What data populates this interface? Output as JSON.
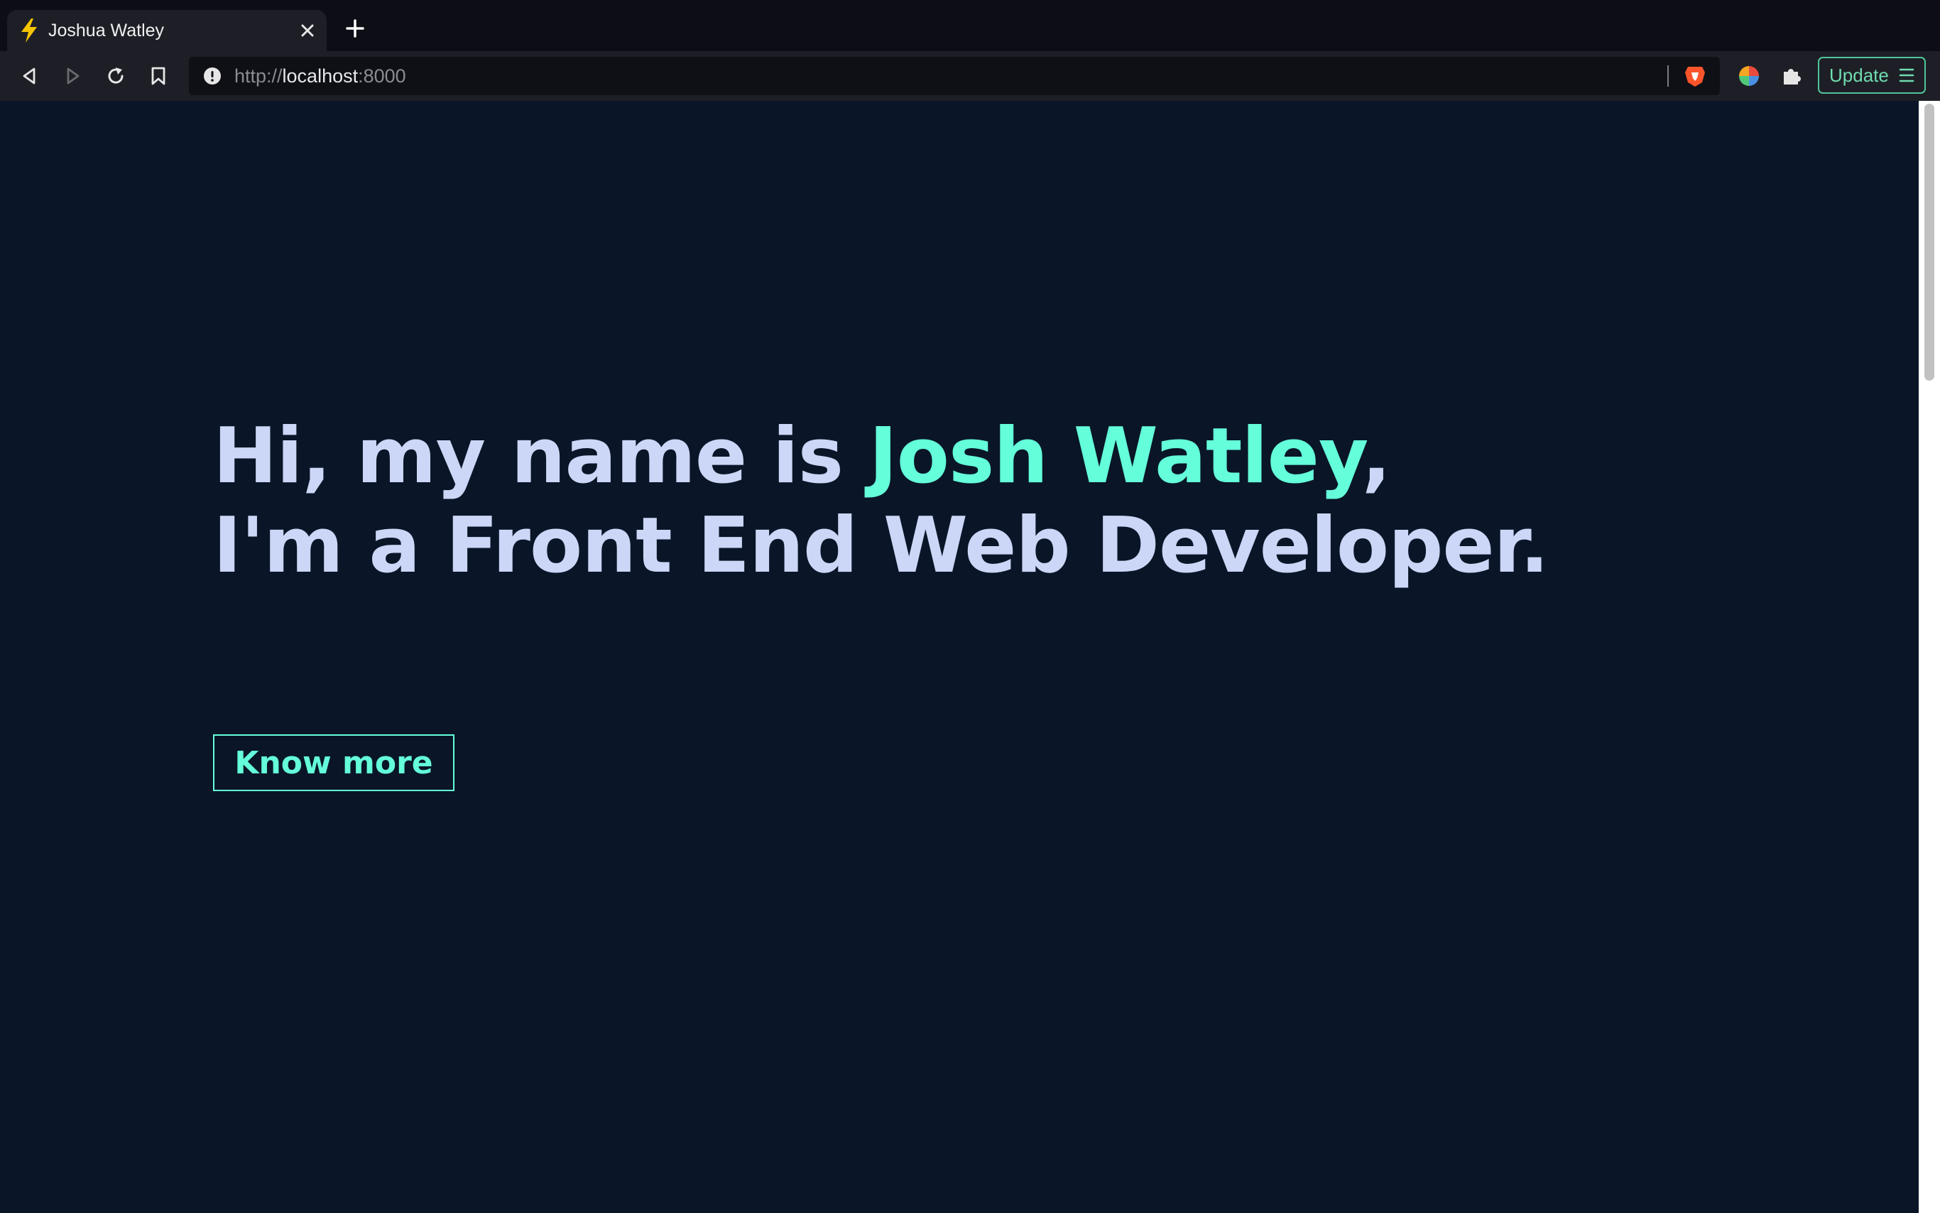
{
  "browser": {
    "tab": {
      "title": "Joshua Watley",
      "favicon": "lightning-bolt-icon",
      "close_icon": "close-icon"
    },
    "new_tab_icon": "plus-icon",
    "toolbar": {
      "back_icon": "back-arrow-icon",
      "forward_icon": "forward-arrow-icon",
      "reload_icon": "reload-icon",
      "bookmark_icon": "bookmark-icon",
      "url_scheme": "http://",
      "url_host": "localhost",
      "url_port": ":8000",
      "site_info_icon": "info-icon",
      "brave_shields_icon": "brave-lion-icon",
      "extension_color_icon": "color-wheel-icon",
      "extensions_icon": "puzzle-piece-icon",
      "update_label": "Update",
      "update_menu_icon": "hamburger-menu-icon"
    }
  },
  "page": {
    "greeting_prefix": "Hi, my name is ",
    "name": "Josh Watley",
    "greeting_suffix": ",",
    "tagline": "I'm a Front End Web Developer.",
    "cta_label": "Know more"
  },
  "colors": {
    "background": "#0a1628",
    "heading": "#ccd6f6",
    "accent": "#64ffda"
  }
}
